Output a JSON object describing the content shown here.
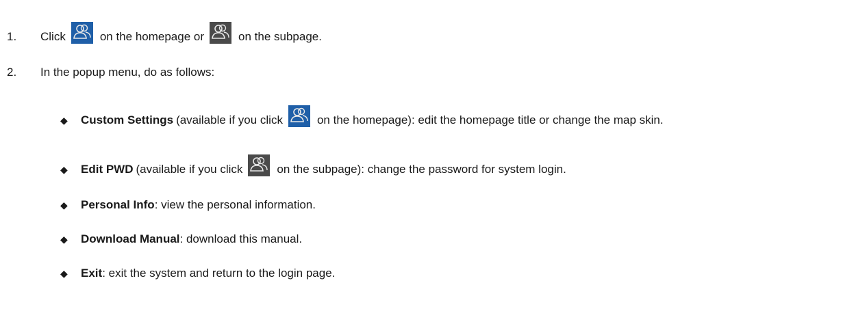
{
  "steps": [
    {
      "number": "1.",
      "before": "Click",
      "middle": "on the homepage or",
      "after": "on the subpage."
    },
    {
      "number": "2.",
      "text": "In the popup menu, do as follows:"
    }
  ],
  "bullet_symbol": "◆",
  "items": [
    {
      "label": "Custom Settings",
      "before_icon": "(available if you click",
      "after_icon": "on the homepage): edit the homepage title or change the map skin.",
      "icon": "homepage-user-icon"
    },
    {
      "label": "Edit PWD",
      "before_icon": "(available if you click",
      "after_icon": "on the subpage): change the password for system login.",
      "icon": "subpage-user-icon"
    },
    {
      "label": "Personal Info",
      "text": ": view the personal information."
    },
    {
      "label": "Download Manual",
      "text": ": download this manual."
    },
    {
      "label": "Exit",
      "text": ": exit the system and return to the login page."
    }
  ],
  "colors": {
    "homepage_icon_bg": "#1f5fa8",
    "subpage_icon_bg": "#4a4a4a",
    "icon_stroke": "#e8e8e8"
  }
}
